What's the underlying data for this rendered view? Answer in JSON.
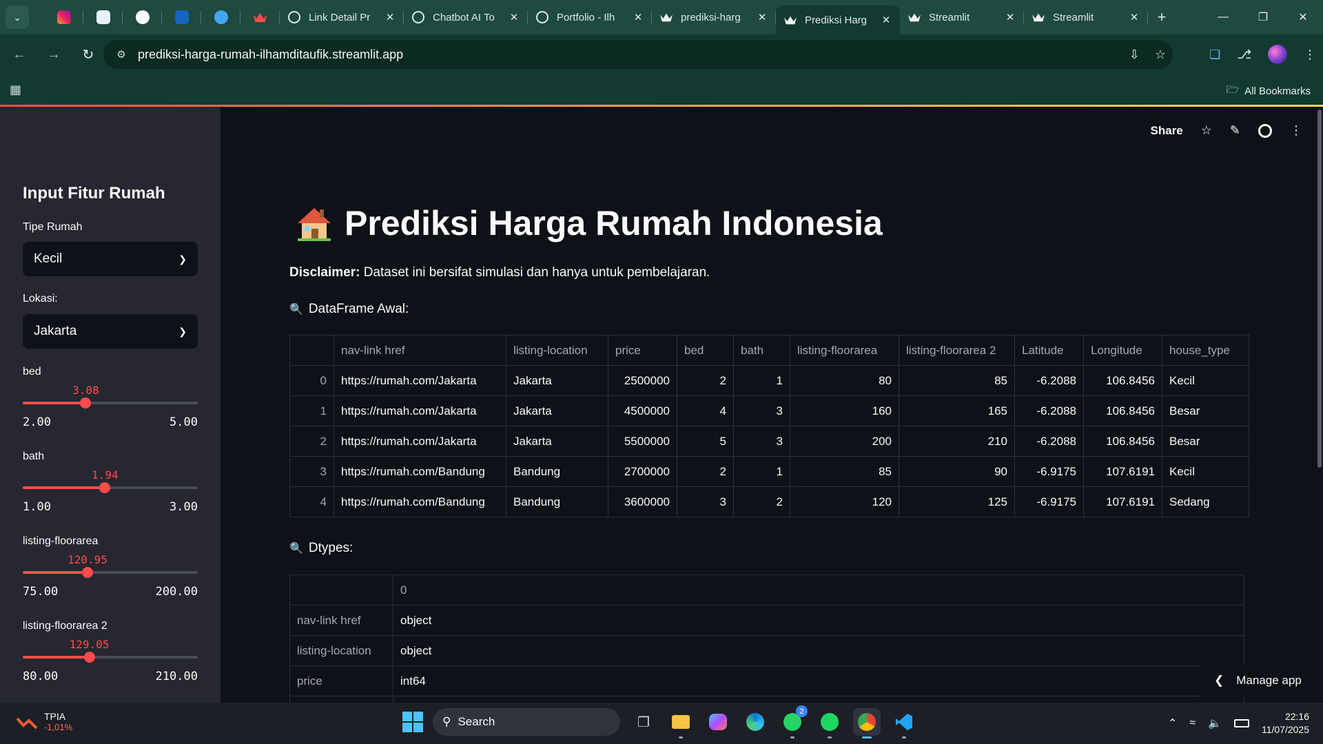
{
  "browser": {
    "tabs": [
      {
        "title": "Link Detail Pr",
        "icon": "link-icon"
      },
      {
        "title": "Chatbot AI To",
        "icon": "globe-icon"
      },
      {
        "title": "Portfolio - Ilh",
        "icon": "globe-icon"
      },
      {
        "title": "prediksi-harg",
        "icon": "streamlit-icon"
      },
      {
        "title": "Prediksi Harg",
        "icon": "streamlit-icon",
        "active": true
      },
      {
        "title": "Streamlit",
        "icon": "streamlit-icon"
      },
      {
        "title": "Streamlit",
        "icon": "streamlit-icon"
      }
    ],
    "url": "prediksi-harga-rumah-ilhamditaufik.streamlit.app",
    "bookmarks_label": "All Bookmarks"
  },
  "sidebar": {
    "title": "Input Fitur Rumah",
    "tipe_label": "Tipe Rumah",
    "tipe_value": "Kecil",
    "lokasi_label": "Lokasi:",
    "lokasi_value": "Jakarta",
    "sliders": [
      {
        "label": "bed",
        "value": "3.08",
        "min": "2.00",
        "max": "5.00",
        "fraction": 0.36
      },
      {
        "label": "bath",
        "value": "1.94",
        "min": "1.00",
        "max": "3.00",
        "fraction": 0.47
      },
      {
        "label": "listing-floorarea",
        "value": "120.95",
        "min": "75.00",
        "max": "200.00",
        "fraction": 0.37
      },
      {
        "label": "listing-floorarea 2",
        "value": "129.05",
        "min": "80.00",
        "max": "210.00",
        "fraction": 0.38
      }
    ]
  },
  "header": {
    "share": "Share"
  },
  "main": {
    "title": "Prediksi Harga Rumah Indonesia",
    "disclaimer_bold": "Disclaimer:",
    "disclaimer_text": " Dataset ini bersifat simulasi dan hanya untuk pembelajaran.",
    "df_heading": "DataFrame Awal:",
    "dtypes_heading": "Dtypes:",
    "df_columns": [
      "",
      "nav-link href",
      "listing-location",
      "price",
      "bed",
      "bath",
      "listing-floorarea",
      "listing-floorarea 2",
      "Latitude",
      "Longitude",
      "house_type"
    ],
    "df_rows": [
      [
        "0",
        "https://rumah.com/Jakarta",
        "Jakarta",
        "2500000",
        "2",
        "1",
        "80",
        "85",
        "-6.2088",
        "106.8456",
        "Kecil"
      ],
      [
        "1",
        "https://rumah.com/Jakarta",
        "Jakarta",
        "4500000",
        "4",
        "3",
        "160",
        "165",
        "-6.2088",
        "106.8456",
        "Besar"
      ],
      [
        "2",
        "https://rumah.com/Jakarta",
        "Jakarta",
        "5500000",
        "5",
        "3",
        "200",
        "210",
        "-6.2088",
        "106.8456",
        "Besar"
      ],
      [
        "3",
        "https://rumah.com/Bandung",
        "Bandung",
        "2700000",
        "2",
        "1",
        "85",
        "90",
        "-6.9175",
        "107.6191",
        "Kecil"
      ],
      [
        "4",
        "https://rumah.com/Bandung",
        "Bandung",
        "3600000",
        "3",
        "2",
        "120",
        "125",
        "-6.9175",
        "107.6191",
        "Sedang"
      ]
    ],
    "dtypes_columns": [
      "",
      "0"
    ],
    "dtypes_rows": [
      [
        "nav-link href",
        "object"
      ],
      [
        "listing-location",
        "object"
      ],
      [
        "price",
        "int64"
      ]
    ],
    "manage_app": "Manage app"
  },
  "taskbar": {
    "stock_name": "TPIA",
    "stock_change": "-1,01%",
    "search_placeholder": "Search",
    "whatsapp_badge": "2",
    "time": "22:16",
    "date": "11/07/2025"
  }
}
